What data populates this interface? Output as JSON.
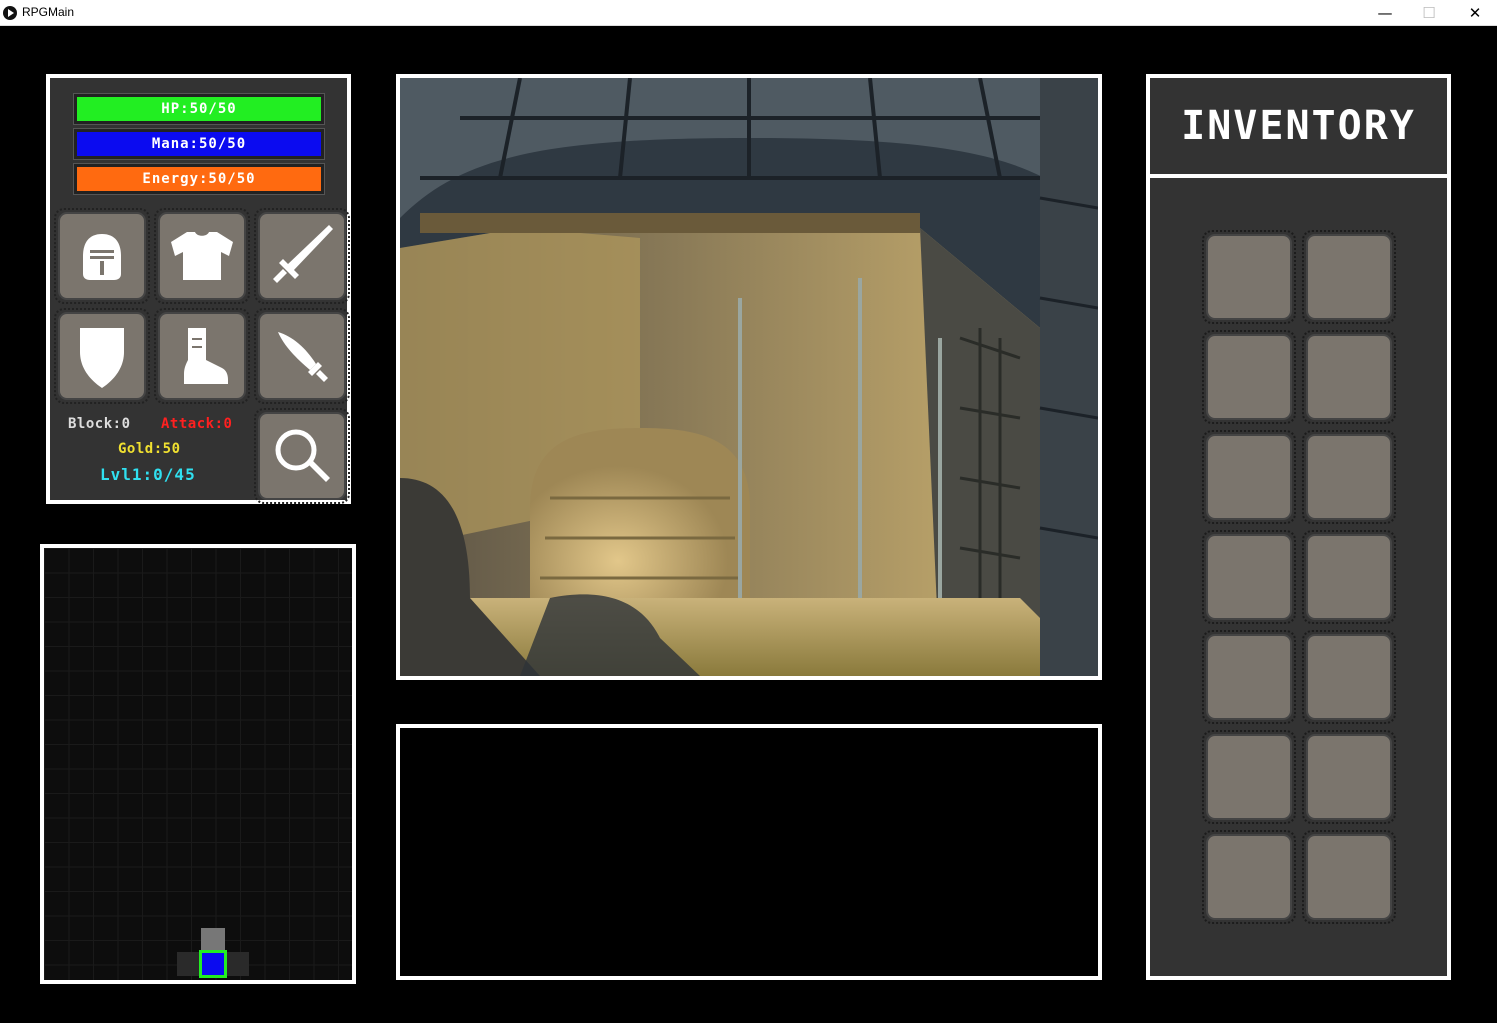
{
  "window": {
    "title": "RPGMain",
    "minimize": "—",
    "maximize": "☐",
    "close": "✕"
  },
  "stats": {
    "hp": "HP:50/50",
    "mana": "Mana:50/50",
    "energy": "Energy:50/50",
    "block": "Block:0",
    "attack": "Attack:0",
    "gold": "Gold:50",
    "level": "Lvl1:0/45"
  },
  "equipment": {
    "slots": [
      "helmet-icon",
      "chestplate-icon",
      "sword-icon",
      "shield-icon",
      "boot-icon",
      "dagger-icon"
    ],
    "inspect": "magnifier-icon"
  },
  "inventory": {
    "title": "INVENTORY",
    "slot_count": 14
  },
  "message_box": {
    "text": ""
  },
  "colors": {
    "hp": "#22ee22",
    "mana": "#0b0bf0",
    "energy": "#ff6a10",
    "attack": "#ff2020",
    "gold": "#f0e030",
    "level": "#30e0f0",
    "player_marker": "#0b0bf0",
    "player_border": "#22ee22",
    "slot": "#7b756d",
    "panel": "#333333"
  }
}
